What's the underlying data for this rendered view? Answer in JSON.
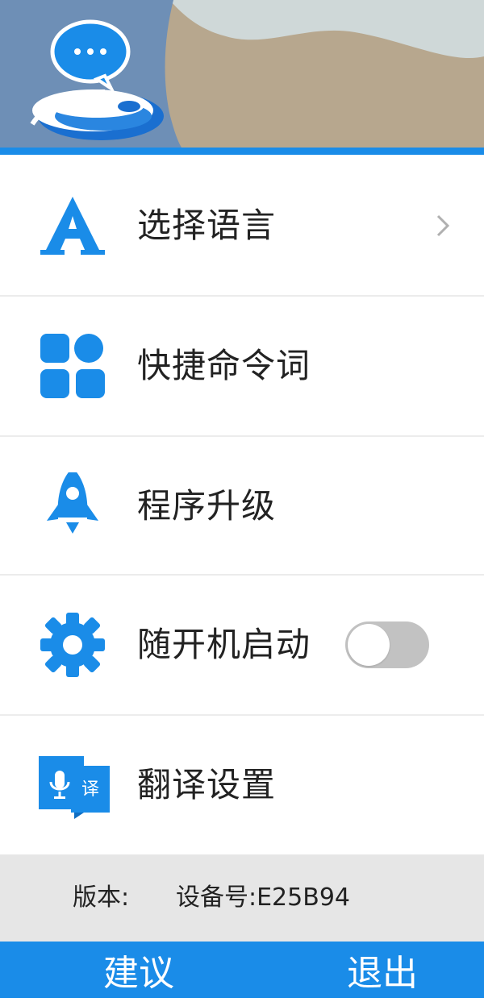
{
  "header": {
    "logo_icon": "chat-bubble-mouse-logo",
    "accent_color": "#1a8ce8"
  },
  "menu": {
    "items": [
      {
        "label": "选择语言",
        "icon": "letter-a-icon"
      },
      {
        "label": "快捷命令词",
        "icon": "grid-apps-icon"
      },
      {
        "label": "程序升级",
        "icon": "rocket-icon"
      },
      {
        "label": "随开机启动",
        "icon": "gear-icon",
        "toggle_on": false
      },
      {
        "label": "翻译设置",
        "icon": "translate-mic-icon"
      }
    ]
  },
  "info": {
    "version_label": "版本:",
    "device_label": "设备号:E25B94"
  },
  "footer": {
    "suggest_label": "建议",
    "exit_label": "退出"
  }
}
